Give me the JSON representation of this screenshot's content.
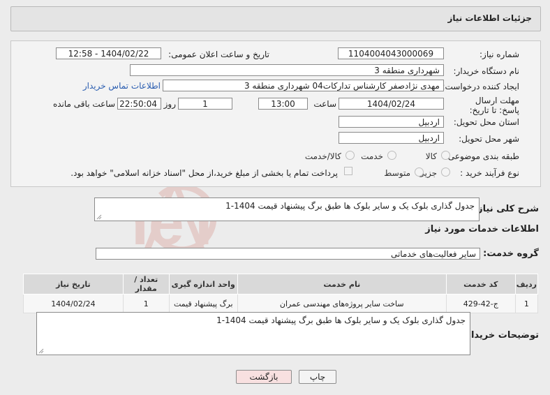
{
  "header": {
    "title": "جزئیات اطلاعات نیاز"
  },
  "form": {
    "need_number_label": "شماره نیاز:",
    "need_number": "1104004043000069",
    "announce_label": "تاریخ و ساعت اعلان عمومی:",
    "announce_value": "1404/02/22 - 12:58",
    "buyer_org_label": "نام دستگاه خریدار:",
    "buyer_org": "شهرداری منطقه 3",
    "creator_label": "ایجاد کننده درخواست:",
    "creator": "مهدی نژادصفر کارشناس تدارکات04 شهرداری منطقه 3",
    "contact_link": "اطلاعات تماس خریدار",
    "deadline_label": "مهلت ارسال پاسخ: تا تاریخ:",
    "deadline_date": "1404/02/24",
    "time_label": "ساعت",
    "deadline_time": "13:00",
    "days_value": "1",
    "days_label": "روز و",
    "remaining_value": "22:50:04",
    "remaining_label": "ساعت باقی مانده",
    "province_label": "استان محل تحویل:",
    "province": "اردبیل",
    "city_label": "شهر محل تحویل:",
    "city": "اردبیل",
    "category_label": "طبقه بندی موضوعی:",
    "category_options": [
      "کالا",
      "خدمت",
      "کالا/خدمت"
    ],
    "process_label": "نوع فرآیند خرید :",
    "process_options": [
      "جزیی",
      "متوسط"
    ],
    "payment_note": "پرداخت تمام یا بخشی از مبلغ خرید،از محل \"اسناد خزانه اسلامی\" خواهد بود."
  },
  "summary": {
    "label": "شرح کلی نیاز:",
    "text": "جدول گذاری بلوک یک و سایر بلوک ها طبق برگ پیشنهاد قیمت  1404-1"
  },
  "services": {
    "section_title": "اطلاعات خدمات مورد نیاز",
    "group_label": "گروه خدمت:",
    "group_value": "سایر فعالیت‌های خدماتی",
    "columns": [
      "ردیف",
      "کد خدمت",
      "نام خدمت",
      "واحد اندازه گیری",
      "تعداد / مقدار",
      "تاریخ نیاز"
    ],
    "rows": [
      [
        "1",
        "ج-42-429",
        "ساخت سایر پروژه‌های مهندسی عمران",
        "برگ پیشنهاد قیمت",
        "1",
        "1404/02/24"
      ]
    ]
  },
  "buyer_notes": {
    "label": "توضیحات خریدار:",
    "text": "جدول گذاری بلوک یک و سایر بلوک ها طبق برگ پیشنهاد قیمت  1404-1"
  },
  "buttons": {
    "print": "چاپ",
    "back": "بازگشت"
  },
  "watermark": {
    "text": "AriaTender.neT"
  },
  "colors": {
    "link": "#2a5db0",
    "back_button_bg": "#f8e0e0",
    "watermark": "#c0392b"
  }
}
